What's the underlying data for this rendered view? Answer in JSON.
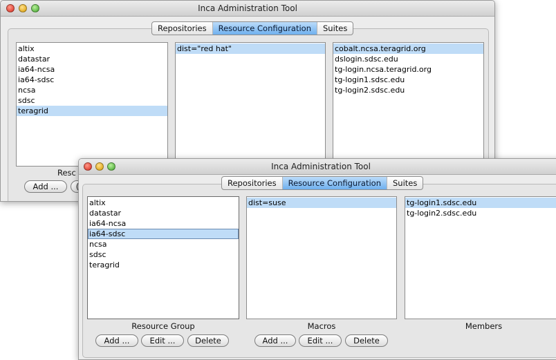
{
  "back_window": {
    "title": "Inca Administration Tool",
    "tabs": [
      "Repositories",
      "Resource Configuration",
      "Suites"
    ],
    "active_tab": 1,
    "resource_groups": [
      "altix",
      "datastar",
      "ia64-ncsa",
      "ia64-sdsc",
      "ncsa",
      "sdsc",
      "teragrid"
    ],
    "selected_group": 6,
    "macros": [
      "dist=\"red hat\""
    ],
    "members": [
      "cobalt.ncsa.teragrid.org",
      "dslogin.sdsc.edu",
      "tg-login.ncsa.teragrid.org",
      "tg-login1.sdsc.edu",
      "tg-login2.sdsc.edu"
    ],
    "group_caption_partial": "Resc",
    "add_label": "Add ...",
    "edit_label_partial": "("
  },
  "front_window": {
    "title": "Inca Administration Tool",
    "tabs": [
      "Repositories",
      "Resource Configuration",
      "Suites"
    ],
    "active_tab": 1,
    "resource_groups": [
      "altix",
      "datastar",
      "ia64-ncsa",
      "ia64-sdsc",
      "ncsa",
      "sdsc",
      "teragrid"
    ],
    "selected_group": 3,
    "macros": [
      "dist=suse"
    ],
    "members": [
      "tg-login1.sdsc.edu",
      "tg-login2.sdsc.edu"
    ],
    "captions": {
      "resource_group": "Resource Group",
      "macros": "Macros",
      "members": "Members"
    },
    "group_buttons": {
      "add": "Add ...",
      "edit": "Edit ...",
      "delete": "Delete"
    },
    "macro_buttons": {
      "add": "Add ...",
      "edit": "Edit ...",
      "delete": "Delete"
    }
  },
  "colors": {
    "selection": "#bfdcf7",
    "active_tab": "#6fb0ee",
    "window_bg": "#ececec"
  }
}
